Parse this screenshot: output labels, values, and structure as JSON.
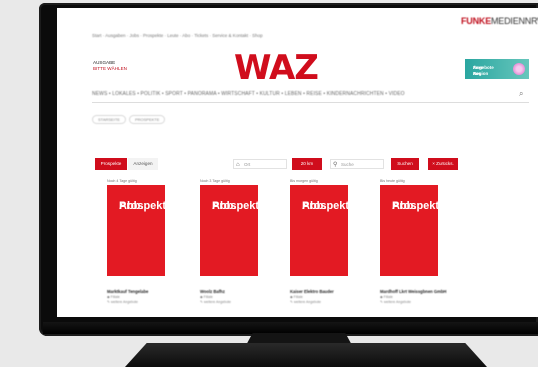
{
  "header": {
    "brand_prefix": "FUNKE",
    "brand_rest": "MEDIENNRW",
    "topnav": "Start · Ausgaben · Jobs · Prospekte · Leute · Abo · Tickets · Service & Kontakt · Shop",
    "ausgabe_label": "AUSGABE",
    "ausgabe_choose": "BITTE WÄHLEN",
    "logo": "WAZ",
    "ad_text_1": "Angebote aus",
    "ad_text_2": "Ihrer Region"
  },
  "nav": {
    "items": "NEWS • LOKALES • POLITIK • SPORT • PANORAMA • WIRTSCHAFT • KULTUR • LEBEN • REISE • KINDERNACHRICHTEN • VIDEO",
    "search_icon": "search-icon"
  },
  "chips": [
    "STARSEITE",
    "PROSPEKTE"
  ],
  "filters": {
    "prospekte_label": "Prospekte",
    "anzeigen_label": "Anzeigen",
    "ort_placeholder": "Ort",
    "umkreis_label": "20 km",
    "suche_placeholder": "Suche",
    "suchen_label": "Suchen",
    "zuruecksetzen_label": "× Zurücks."
  },
  "cards": [
    {
      "date": "Noch 4 Tage gültig",
      "image_label_1": "Abb.",
      "image_label_2": "Prospekt",
      "name": "Marktkauf Tengelabe",
      "meta_1": "Filiale",
      "meta_2": "weitere Angebote"
    },
    {
      "date": "Noch 3 Tage gültig",
      "image_label_1": "Abb.",
      "image_label_2": "Prospekt",
      "name": "Woolz Bafhz",
      "meta_1": "Filiale",
      "meta_2": "weitere Angebote"
    },
    {
      "date": "Bis morgen gültig",
      "image_label_1": "Abb.",
      "image_label_2": "Prospekt",
      "name": "Kaiser Elektro Bauder",
      "meta_1": "Filiale",
      "meta_2": "weitere Angebote"
    },
    {
      "date": "Bis heute gültig",
      "image_label_1": "Abb.",
      "image_label_2": "Prospekt",
      "name": "Mardhoff Lkrt Weissgbnen GmbH",
      "meta_1": "Filiale",
      "meta_2": "weitere Angebote"
    }
  ],
  "colors": {
    "accent": "#d00d1c",
    "card": "#e31a23"
  }
}
